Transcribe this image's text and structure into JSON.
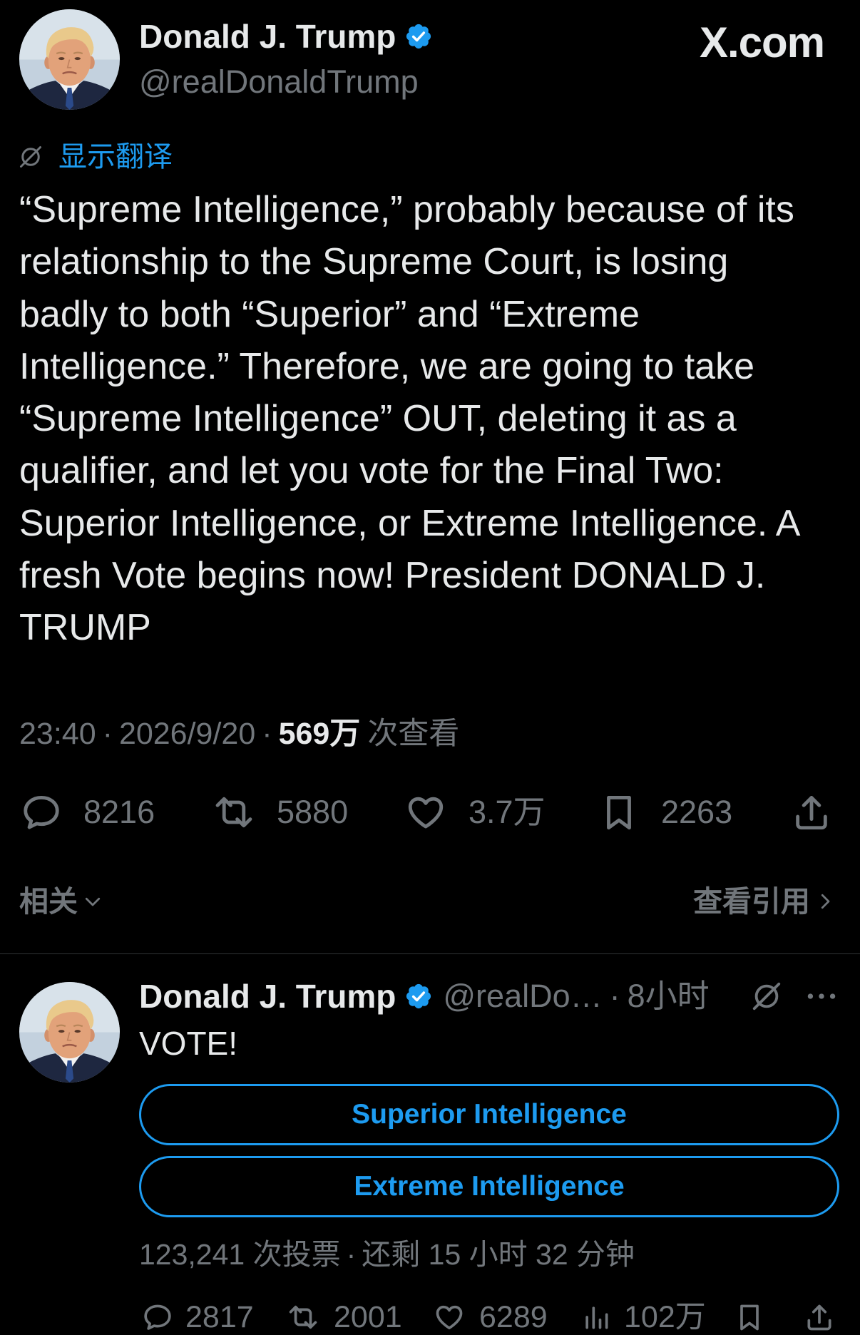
{
  "brand": "X.com",
  "colors": {
    "background": "#000000",
    "text": "#e7e9ea",
    "muted": "#71767b",
    "accent": "#1d9bf0",
    "divider": "#2f3336"
  },
  "icons": {
    "verified": "verified-badge-icon",
    "translate": "globe-slash-icon",
    "reply": "reply-icon",
    "repost": "repost-icon",
    "like": "heart-icon",
    "bookmark": "bookmark-icon",
    "share": "share-icon",
    "views": "views-icon",
    "more": "more-icon"
  },
  "post": {
    "author": {
      "name": "Donald J. Trump",
      "handle": "@realDonaldTrump",
      "verified": true
    },
    "translate_label": "显示翻译",
    "text_lines": [
      "“Supreme Intelligence,” probably because of its",
      "relationship to the Supreme Court, is losing",
      "badly to both “Superior” and “Extreme",
      "Intelligence.” Therefore, we are going to take",
      "“Supreme Intelligence” OUT, deleting it as a",
      "qualifier, and let you vote for the Final Two:",
      "Superior Intelligence, or Extreme Intelligence. A",
      "fresh Vote begins now! President DONALD J.",
      "TRUMP"
    ],
    "meta": {
      "time": "23:40",
      "separator": "·",
      "date": "2026/9/20",
      "views": "569万",
      "views_label": "次查看"
    },
    "stats": {
      "replies": "8216",
      "reposts": "5880",
      "likes": "3.7万",
      "bookmarks": "2263"
    }
  },
  "related_bar": {
    "label": "相关",
    "view_quotes_label": "查看引用"
  },
  "related_post": {
    "author": {
      "name": "Donald J. Trump",
      "handle": "@realDo…",
      "verified": true
    },
    "separator": "·",
    "time_ago": "8小时",
    "text": "VOTE!",
    "poll": {
      "options": [
        "Superior Intelligence",
        "Extreme Intelligence"
      ],
      "votes": "123,241 次投票",
      "separator": "·",
      "remaining": "还剩 15 小时 32 分钟"
    },
    "stats": {
      "replies": "2817",
      "reposts": "2001",
      "likes": "6289",
      "views": "102万"
    }
  }
}
